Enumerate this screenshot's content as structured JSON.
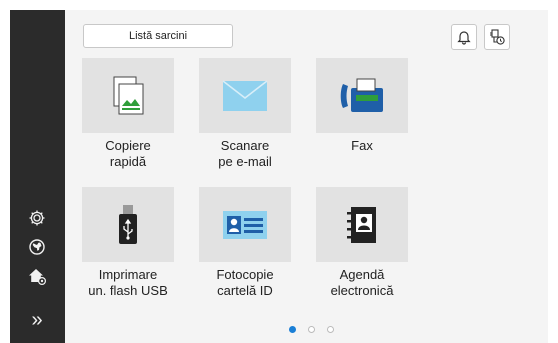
{
  "header": {
    "task_list_label": "Listă sarcini"
  },
  "tiles": [
    {
      "line1": "Copiere",
      "line2": "rapidă"
    },
    {
      "line1": "Scanare",
      "line2": "pe e-mail"
    },
    {
      "line1": "Fax",
      "line2": ""
    },
    {
      "line1": "Imprimare",
      "line2": "un. flash USB"
    },
    {
      "line1": "Fotocopie",
      "line2": "cartelă ID"
    },
    {
      "line1": "Agendă",
      "line2": "electronică"
    }
  ],
  "icons": {
    "bell": "bell-icon",
    "device_status": "device-status-icon",
    "settings": "settings-gear-icon",
    "globe": "globe-icon",
    "home": "home-settings-icon",
    "expand": "double-chevron-right-icon"
  },
  "sidebar": {
    "expand_glyph": "»"
  },
  "pagination": {
    "current_page": 1,
    "total_pages": 3
  },
  "colors": {
    "sidebar_bg": "#2b2b2b",
    "accent": "#1a7fd6",
    "envelope": "#8fd1ee"
  }
}
